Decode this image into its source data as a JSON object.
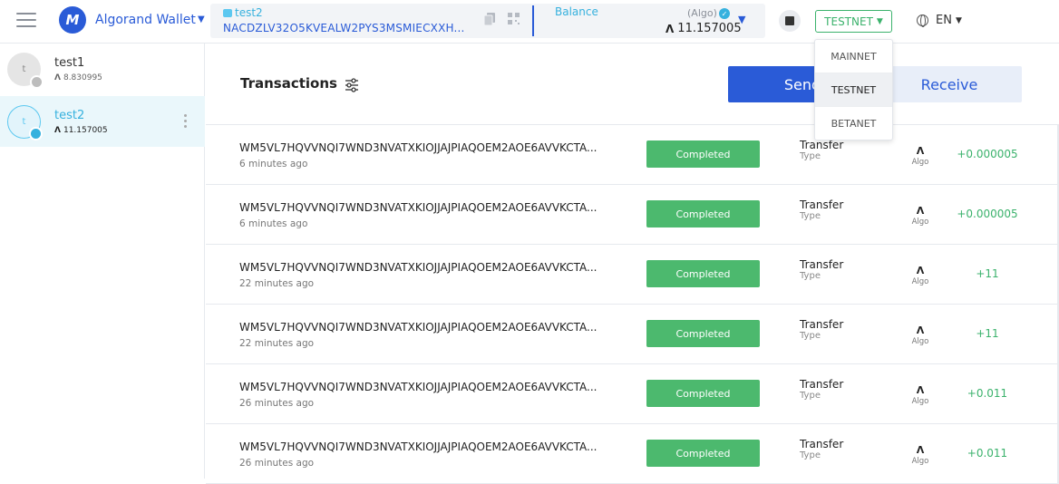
{
  "header": {
    "brand_name": "Algorand Wallet",
    "brand_logo_letter": "M",
    "account_name": "test2",
    "account_address": "NACDZLV32O5KVEALW2PYS3MSMIECXXH...",
    "balance_label": "Balance",
    "balance_unit": "(Algo)",
    "balance_value": "11.157005",
    "network_selected": "TESTNET",
    "language": "EN"
  },
  "sidebar": {
    "accounts": [
      {
        "initial": "t",
        "name": "test1",
        "balance": "8.830995"
      },
      {
        "initial": "t",
        "name": "test2",
        "balance": "11.157005"
      }
    ]
  },
  "main": {
    "title": "Transactions",
    "send_label": "Send",
    "receive_label": "Receive",
    "transactions": [
      {
        "id": "WM5VL7HQVVNQI7WND3NVATXKIOJJAJPIAQOEM2AOE6AVVKCTA...",
        "time": "6 minutes ago",
        "status": "Completed",
        "type": "Transfer",
        "type_label": "Type",
        "asset": "Algo",
        "amount": "+0.000005"
      },
      {
        "id": "WM5VL7HQVVNQI7WND3NVATXKIOJJAJPIAQOEM2AOE6AVVKCTA...",
        "time": "6 minutes ago",
        "status": "Completed",
        "type": "Transfer",
        "type_label": "Type",
        "asset": "Algo",
        "amount": "+0.000005"
      },
      {
        "id": "WM5VL7HQVVNQI7WND3NVATXKIOJJAJPIAQOEM2AOE6AVVKCTA...",
        "time": "22 minutes ago",
        "status": "Completed",
        "type": "Transfer",
        "type_label": "Type",
        "asset": "Algo",
        "amount": "+11"
      },
      {
        "id": "WM5VL7HQVVNQI7WND3NVATXKIOJJAJPIAQOEM2AOE6AVVKCTA...",
        "time": "22 minutes ago",
        "status": "Completed",
        "type": "Transfer",
        "type_label": "Type",
        "asset": "Algo",
        "amount": "+11"
      },
      {
        "id": "WM5VL7HQVVNQI7WND3NVATXKIOJJAJPIAQOEM2AOE6AVVKCTA...",
        "time": "26 minutes ago",
        "status": "Completed",
        "type": "Transfer",
        "type_label": "Type",
        "asset": "Algo",
        "amount": "+0.011"
      },
      {
        "id": "WM5VL7HQVVNQI7WND3NVATXKIOJJAJPIAQOEM2AOE6AVVKCTA...",
        "time": "26 minutes ago",
        "status": "Completed",
        "type": "Transfer",
        "type_label": "Type",
        "asset": "Algo",
        "amount": "+0.011"
      }
    ]
  },
  "network_menu": {
    "options": [
      "MAINNET",
      "TESTNET",
      "BETANET"
    ]
  },
  "colors": {
    "primary": "#2a5bd7",
    "accent": "#36b1de",
    "success": "#4cb96e"
  }
}
